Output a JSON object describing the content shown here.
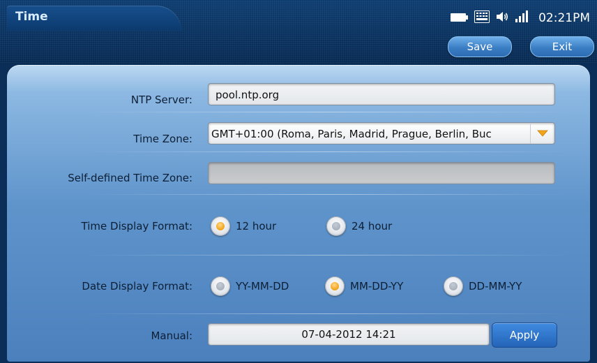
{
  "header": {
    "title": "Time",
    "clock": "02:21PM",
    "status_icons": [
      "battery-icon",
      "keyboard-icon",
      "speaker-icon",
      "signal-icon"
    ]
  },
  "toolbar": {
    "save_label": "Save",
    "exit_label": "Exit"
  },
  "form": {
    "ntp_server": {
      "label": "NTP Server:",
      "value": "pool.ntp.org"
    },
    "time_zone": {
      "label": "Time Zone:",
      "value": "GMT+01:00 (Roma, Paris, Madrid, Prague, Berlin, Buc"
    },
    "self_defined_tz": {
      "label": "Self-defined Time Zone:",
      "value": ""
    },
    "time_display_format": {
      "label": "Time Display Format:",
      "options": [
        {
          "label": "12 hour",
          "selected": true
        },
        {
          "label": "24 hour",
          "selected": false
        }
      ]
    },
    "date_display_format": {
      "label": "Date Display Format:",
      "options": [
        {
          "label": "YY-MM-DD",
          "selected": false
        },
        {
          "label": "MM-DD-YY",
          "selected": true
        },
        {
          "label": "DD-MM-YY",
          "selected": false
        }
      ]
    },
    "manual": {
      "label": "Manual:",
      "value": "07-04-2012 14:21",
      "apply_label": "Apply"
    }
  },
  "colors": {
    "accent_selected": "#f2a51c",
    "header_bg": "#0a2e57",
    "button_blue": "#3b7ec4"
  }
}
